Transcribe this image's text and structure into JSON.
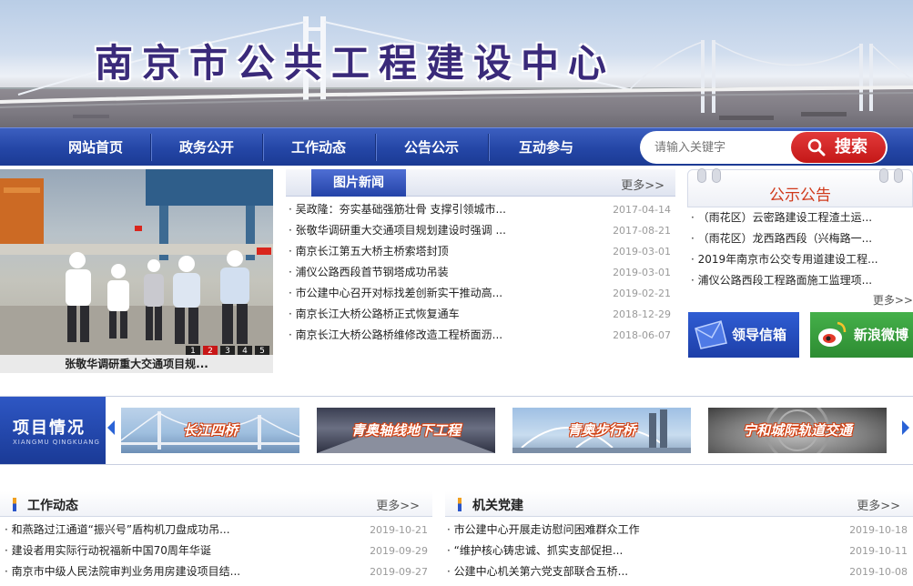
{
  "banner": {
    "title": "南京市公共工程建设中心"
  },
  "nav": {
    "items": [
      "网站首页",
      "政务公开",
      "工作动态",
      "公告公示",
      "互动参与"
    ],
    "search": {
      "placeholder": "请输入关键字",
      "button": "搜索"
    }
  },
  "slider": {
    "caption": "张敬华调研重大交通项目规...",
    "dots": [
      "1",
      "2",
      "3",
      "4",
      "5"
    ],
    "active_dot": 1
  },
  "picture_news": {
    "tab": "图片新闻",
    "more": "更多>>",
    "items": [
      {
        "title": "· 吴政隆：夯实基础强筋壮骨 支撑引领城市...",
        "date": "2017-04-14"
      },
      {
        "title": "· 张敬华调研重大交通项目规划建设时强调 ...",
        "date": "2017-08-21"
      },
      {
        "title": "· 南京长江第五大桥主桥索塔封顶",
        "date": "2019-03-01"
      },
      {
        "title": "· 浦仪公路西段首节钢塔成功吊装",
        "date": "2019-03-01"
      },
      {
        "title": "· 市公建中心召开对标找差创新实干推动高...",
        "date": "2019-02-21"
      },
      {
        "title": "· 南京长江大桥公路桥正式恢复通车",
        "date": "2018-12-29"
      },
      {
        "title": "· 南京长江大桥公路桥维修改造工程桥面沥...",
        "date": "2018-06-07"
      }
    ]
  },
  "notice": {
    "title": "公示公告",
    "more": "更多>>",
    "items": [
      "· （雨花区）云密路建设工程渣土运...",
      "· （雨花区）龙西路西段（兴梅路一...",
      "· 2019年南京市公交专用道建设工程...",
      "· 浦仪公路西段工程路面施工监理项..."
    ]
  },
  "mini_buttons": {
    "letter": "领导信箱",
    "weibo": "新浪微博"
  },
  "projects": {
    "label": "项目情况",
    "label_pinyin": "XIANGMU QINGKUANG",
    "cards": [
      "长江四桥",
      "青奥轴线地下工程",
      "青奥步行桥",
      "宁和城际轨道交通"
    ]
  },
  "work_news": {
    "title": "工作动态",
    "more": "更多>>",
    "items": [
      {
        "title": "· 和燕路过江通道“振兴号”盾构机刀盘成功吊...",
        "date": "2019-10-21"
      },
      {
        "title": "· 建设者用实际行动祝福新中国70周年华诞",
        "date": "2019-09-29"
      },
      {
        "title": "· 南京市中级人民法院审判业务用房建设项目结...",
        "date": "2019-09-27"
      }
    ]
  },
  "party": {
    "title": "机关党建",
    "more": "更多>>",
    "items": [
      {
        "title": "· 市公建中心开展走访慰问困难群众工作",
        "date": "2019-10-18"
      },
      {
        "title": "· “维护核心铸忠诚、抓实支部促担...",
        "date": "2019-10-11"
      },
      {
        "title": "· 公建中心机关第六党支部联合五桥...",
        "date": "2019-10-08"
      }
    ]
  },
  "colors": {
    "nav_blue": "#2446a6",
    "accent_red": "#c81616",
    "notice_red": "#d0391a",
    "weibo_green": "#3aa040"
  }
}
